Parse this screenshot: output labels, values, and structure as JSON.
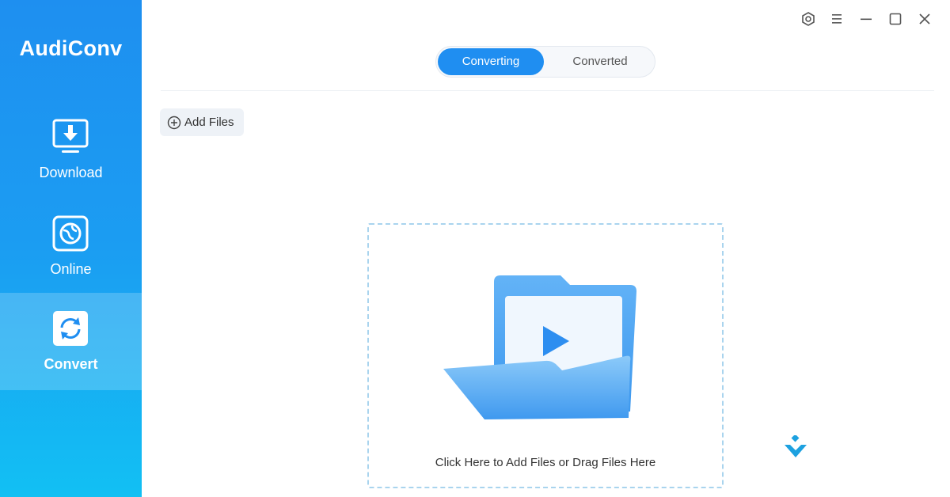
{
  "app": {
    "name": "AudiConv"
  },
  "sidebar": {
    "items": [
      {
        "label": "Download",
        "icon": "download-icon",
        "active": false
      },
      {
        "label": "Online",
        "icon": "globe-icon",
        "active": false
      },
      {
        "label": "Convert",
        "icon": "convert-icon",
        "active": true
      }
    ]
  },
  "window_controls": [
    "settings-icon",
    "menu-icon",
    "minimize-icon",
    "maximize-icon",
    "close-icon"
  ],
  "tabs": [
    {
      "label": "Converting",
      "active": true
    },
    {
      "label": "Converted",
      "active": false
    }
  ],
  "toolbar": {
    "add_files_label": "Add Files"
  },
  "dropzone": {
    "text": "Click Here to Add Files or Drag Files Here"
  },
  "colors": {
    "accent": "#1f8ef1",
    "sidebar_top": "#1e8ff0",
    "sidebar_bottom": "#12c0f3",
    "dropzone_border": "#a9d4ee"
  }
}
